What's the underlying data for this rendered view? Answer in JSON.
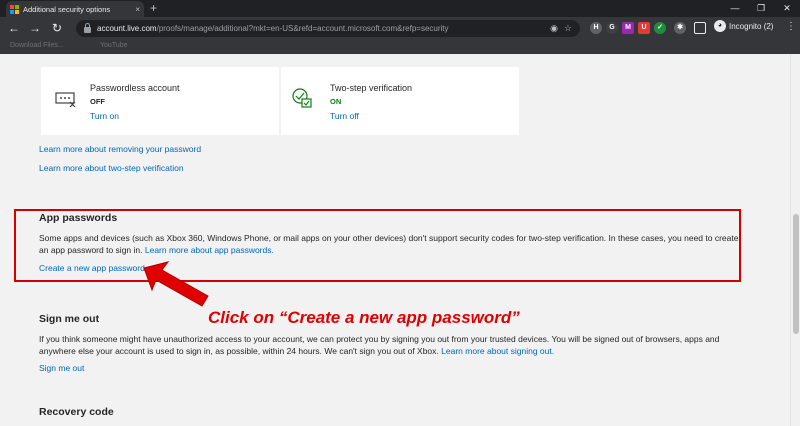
{
  "browser": {
    "tab_title": "Additional security options",
    "tab_close": "×",
    "new_tab": "+",
    "window_controls": [
      "—",
      "❐",
      "✕"
    ],
    "nav": {
      "back": "←",
      "forward": "→",
      "reload": "↻"
    },
    "url_host": "account.live.com",
    "url_path": "/proofs/manage/additional?mkt=en-US&refd=account.microsoft.com&refp=security",
    "extensions": [
      {
        "label": "H",
        "color": "#5f6368"
      },
      {
        "label": "G",
        "color": "#3c4043"
      },
      {
        "label": "M",
        "color": "#9c27b0"
      },
      {
        "label": "U",
        "color": "#e53935"
      },
      {
        "label": "✓",
        "color": "#1e8e3e"
      },
      {
        "label": "✱",
        "color": "#5f6368"
      }
    ],
    "incognito_label": "Incognito (2)",
    "bookmarks": [
      "Download Files...",
      "YouTube"
    ],
    "ms_logo_colors": [
      "#f25022",
      "#7fba00",
      "#00a4ef",
      "#ffb900"
    ]
  },
  "cards": [
    {
      "title": "Passwordless account",
      "status": "OFF",
      "status_color": "#262626",
      "link": "Turn on",
      "icon": "password-dots-icon"
    },
    {
      "title": "Two-step verification",
      "status": "ON",
      "status_color": "#107c10",
      "link": "Turn off",
      "icon": "shield-check-icon"
    }
  ],
  "links": {
    "remove_password": "Learn more about removing your password",
    "two_step": "Learn more about two-step verification"
  },
  "app_passwords": {
    "heading": "App passwords",
    "description": "Some apps and devices (such as Xbox 360, Windows Phone, or mail apps on your other devices) don't support security codes for two-step verification. In these cases, you need to create an app password to sign in.",
    "learn_more": "Learn more about app passwords.",
    "create_link": "Create a new app password"
  },
  "sign_me_out": {
    "heading": "Sign me out",
    "description": "If you think someone might have unauthorized access to your account, we can protect you by signing you out from your trusted devices. You will be signed out of browsers, apps and anywhere else your account is used to sign in, as possible, within 24 hours. We can't sign you out of Xbox.",
    "learn_more": "Learn more about signing out.",
    "link": "Sign me out"
  },
  "recovery_code": {
    "heading": "Recovery code"
  },
  "annotation": {
    "callout": "Click on “Create a new app password”",
    "color": "#e00000"
  }
}
